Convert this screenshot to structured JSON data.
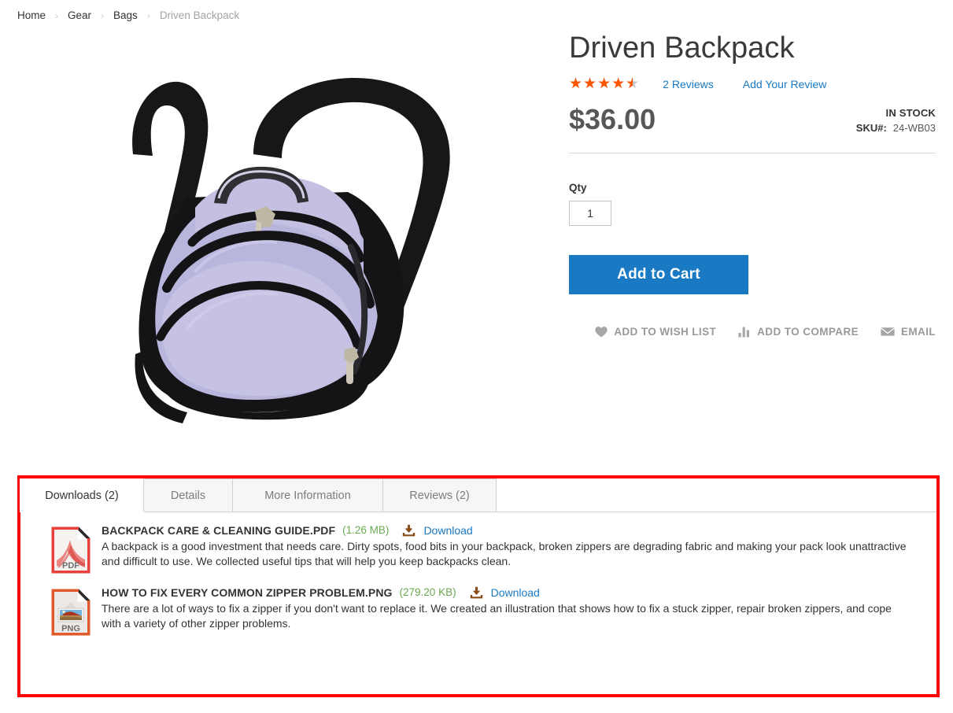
{
  "breadcrumbs": [
    {
      "label": "Home",
      "current": false
    },
    {
      "label": "Gear",
      "current": false
    },
    {
      "label": "Bags",
      "current": false
    },
    {
      "label": "Driven Backpack",
      "current": true
    }
  ],
  "breadcrumb_separator": "›",
  "product": {
    "title": "Driven Backpack",
    "rating_stars": "★★★★★",
    "rating_percent": 90,
    "rating_value": 4.5,
    "reviews_link": "2 Reviews",
    "add_review_link": "Add Your Review",
    "price": "$36.00",
    "stock_status": "IN STOCK",
    "sku_label": "SKU#:",
    "sku_value": "24-WB03",
    "image_alt": "Driven Backpack product photo"
  },
  "purchase": {
    "qty_label": "Qty",
    "qty_value": "1",
    "add_to_cart_label": "Add to Cart"
  },
  "secondary_actions": [
    {
      "label": "ADD TO WISH LIST",
      "icon": "heart-icon"
    },
    {
      "label": "ADD TO COMPARE",
      "icon": "compare-bars-icon"
    },
    {
      "label": "EMAIL",
      "icon": "envelope-icon"
    }
  ],
  "tabs": [
    {
      "label": "Downloads (2)",
      "active": true
    },
    {
      "label": "Details",
      "active": false
    },
    {
      "label": "More Information",
      "active": false
    },
    {
      "label": "Reviews (2)",
      "active": false
    }
  ],
  "downloads": [
    {
      "icon": "pdf-file-icon",
      "icon_label": "PDF",
      "title": "BACKPACK CARE & CLEANING GUIDE.PDF",
      "size": "(1.26 MB)",
      "download_label": "Download",
      "description": "A backpack is a good investment that needs care. Dirty spots, food bits in your backpack, broken zippers are degrading fabric and making your pack look unattractive and difficult to use. We collected useful tips that will help you keep backpacks clean."
    },
    {
      "icon": "png-file-icon",
      "icon_label": "PNG",
      "title": "HOW TO FIX EVERY COMMON ZIPPER PROBLEM.PNG",
      "size": "(279.20 KB)",
      "download_label": "Download",
      "description": "There are a lot of ways to fix a zipper if you don't want to replace it. We created an illustration that shows how to fix a stuck zipper, repair broken zippers, and cope with a variety of other zipper problems."
    }
  ],
  "colors": {
    "accent_blue": "#1979c3",
    "star_orange": "#ff5501",
    "size_green": "#6aa84f",
    "annotation_red": "#fe0000",
    "download_icon_brown": "#8a4f18"
  }
}
